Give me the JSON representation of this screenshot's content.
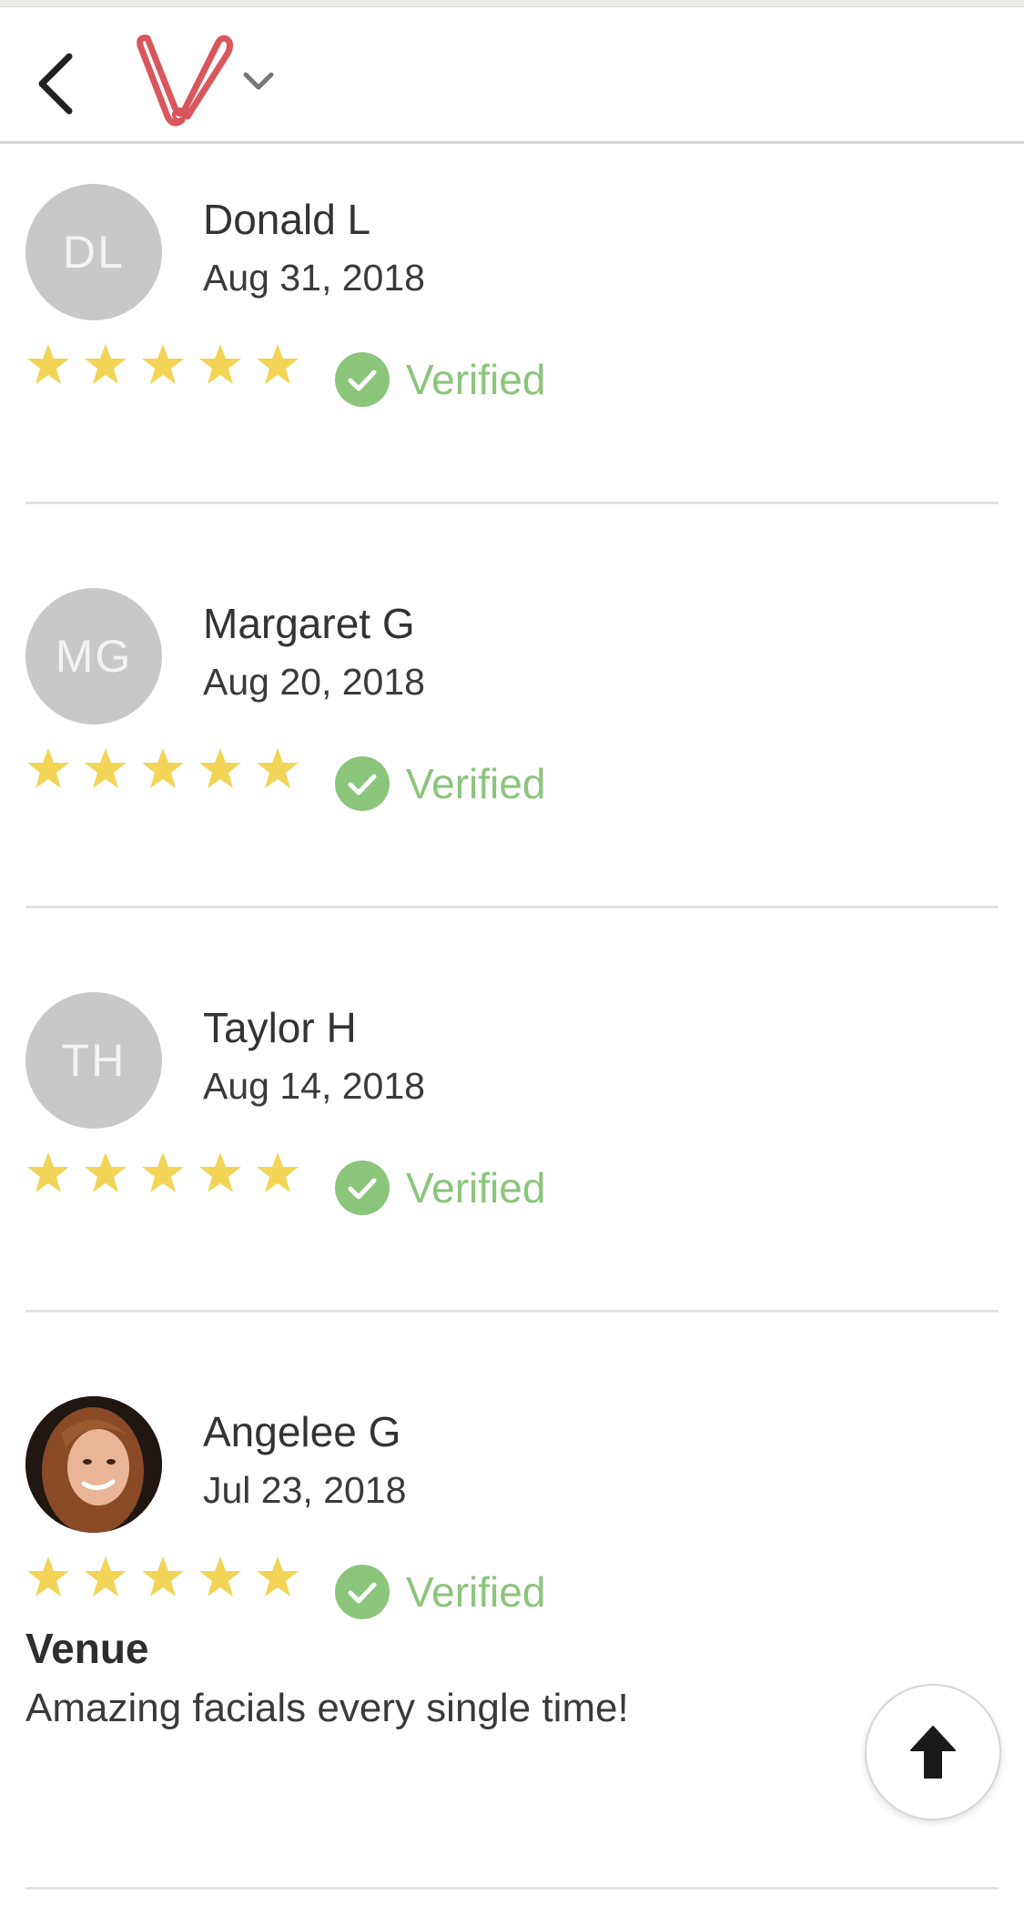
{
  "header": {
    "back_icon": "chevron-left-icon",
    "logo_icon": "vagaro-v-logo",
    "menu_icon": "chevron-down-icon"
  },
  "colors": {
    "star": "#f2d457",
    "verified": "#8bc57c",
    "avatar_bg": "#c8c8c8",
    "logo": "#d9575c"
  },
  "reviews": [
    {
      "initials": "DL",
      "name": "Donald L",
      "date": "Aug 31, 2018",
      "rating": 5,
      "verified_label": "Verified"
    },
    {
      "initials": "MG",
      "name": "Margaret G",
      "date": "Aug 20, 2018",
      "rating": 5,
      "verified_label": "Verified"
    },
    {
      "initials": "TH",
      "name": "Taylor H",
      "date": "Aug 14, 2018",
      "rating": 5,
      "verified_label": "Verified"
    },
    {
      "initials": "",
      "name": "Angelee G",
      "date": "Jul 23, 2018",
      "rating": 5,
      "verified_label": "Verified",
      "title": "Venue",
      "text": "Amazing facials every single time!"
    }
  ],
  "scroll_top_icon": "arrow-up-icon"
}
